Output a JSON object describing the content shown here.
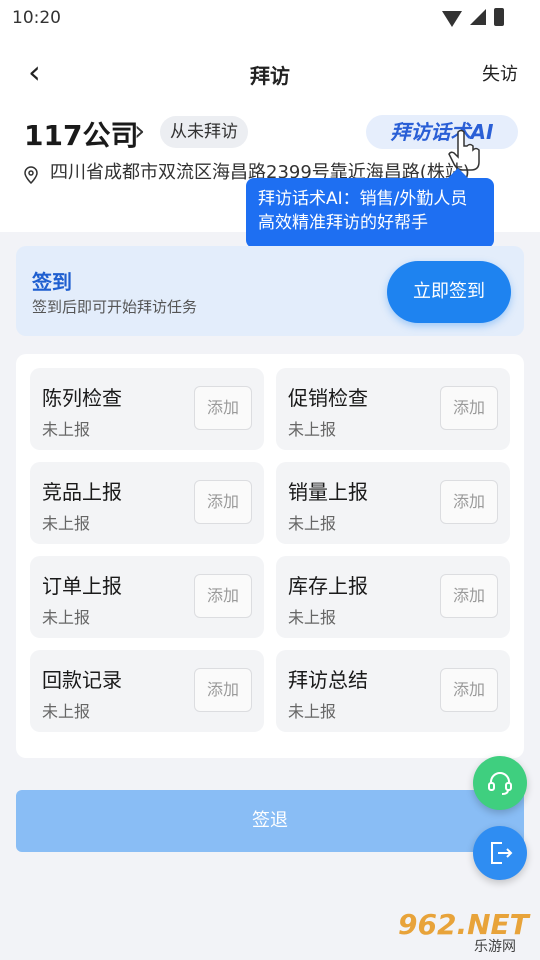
{
  "status_bar": {
    "time": "10:20"
  },
  "nav": {
    "title": "拜访",
    "right_label": "失访"
  },
  "store": {
    "name": "117公司",
    "visit_status": "从未拜访",
    "ai_button_label": "拜访话术AI",
    "address": "四川省成都市双流区海昌路2399号靠近海昌路(株站)"
  },
  "tooltip": {
    "text": "拜访话术AI：销售/外勤人员高效精准拜访的好帮手"
  },
  "checkin": {
    "title": "签到",
    "subtitle": "签到后即可开始拜访任务",
    "button_label": "立即签到"
  },
  "tasks": [
    {
      "name": "陈列检查",
      "status": "未上报",
      "action": "添加"
    },
    {
      "name": "促销检查",
      "status": "未上报",
      "action": "添加"
    },
    {
      "name": "竞品上报",
      "status": "未上报",
      "action": "添加"
    },
    {
      "name": "销量上报",
      "status": "未上报",
      "action": "添加"
    },
    {
      "name": "订单上报",
      "status": "未上报",
      "action": "添加"
    },
    {
      "name": "库存上报",
      "status": "未上报",
      "action": "添加"
    },
    {
      "name": "回款记录",
      "status": "未上报",
      "action": "添加"
    },
    {
      "name": "拜访总结",
      "status": "未上报",
      "action": "添加"
    }
  ],
  "footer": {
    "signout_label": "签退"
  },
  "watermark": {
    "main": "962.NET",
    "sub": "乐游网"
  },
  "colors": {
    "primary": "#1e83f0",
    "green_fab": "#3fcf7f",
    "tooltip_bg": "#1e6ff2"
  }
}
